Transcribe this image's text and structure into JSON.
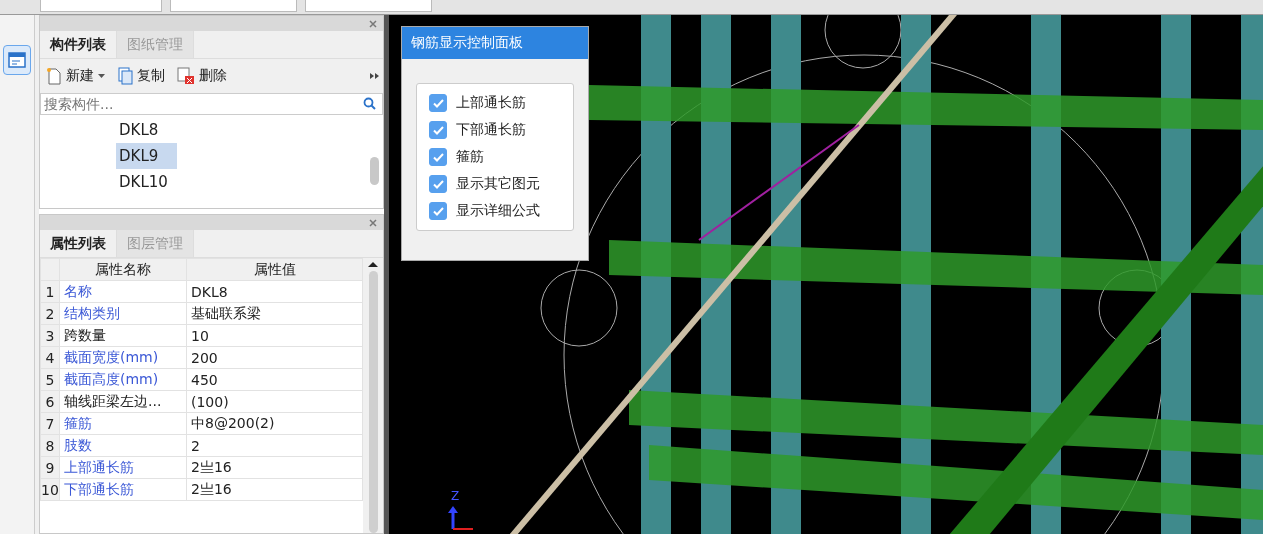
{
  "component_panel": {
    "tabs": [
      {
        "label": "构件列表",
        "selected": true
      },
      {
        "label": "图纸管理",
        "selected": false
      }
    ],
    "toolbar": [
      {
        "label": "新建",
        "kind": "new"
      },
      {
        "label": "复制",
        "kind": "copy"
      },
      {
        "label": "删除",
        "kind": "delete"
      }
    ],
    "search": {
      "placeholder": "搜索构件..."
    },
    "items": [
      {
        "label": "DKL8",
        "selected": false
      },
      {
        "label": "DKL9",
        "selected": true
      },
      {
        "label": "DKL10",
        "selected": false
      }
    ]
  },
  "property_panel": {
    "tabs": [
      {
        "label": "属性列表",
        "selected": true
      },
      {
        "label": "图层管理",
        "selected": false
      }
    ],
    "columns": [
      "属性名称",
      "属性值"
    ],
    "rows": [
      {
        "index": "1",
        "name": "名称",
        "value": "DKL8",
        "kind": "linked"
      },
      {
        "index": "2",
        "name": "结构类别",
        "value": "基础联系梁",
        "kind": "linked"
      },
      {
        "index": "3",
        "name": "跨数量",
        "value": "10",
        "kind": "plain"
      },
      {
        "index": "4",
        "name": "截面宽度(mm)",
        "value": "200",
        "kind": "linked"
      },
      {
        "index": "5",
        "name": "截面高度(mm)",
        "value": "450",
        "kind": "linked"
      },
      {
        "index": "6",
        "name": "轴线距梁左边...",
        "value": "(100)",
        "kind": "plain"
      },
      {
        "index": "7",
        "name": "箍筋",
        "value": "中8@200(2)",
        "kind": "linked"
      },
      {
        "index": "8",
        "name": "肢数",
        "value": "2",
        "kind": "linked"
      },
      {
        "index": "9",
        "name": "上部通长筋",
        "value": "2亗16",
        "kind": "linked"
      },
      {
        "index": "10",
        "name": "下部通长筋",
        "value": "2亗16",
        "kind": "linked"
      }
    ]
  },
  "rebar_panel": {
    "title": "钢筋显示控制面板",
    "options": [
      {
        "label": "上部通长筋",
        "checked": true
      },
      {
        "label": "下部通长筋",
        "checked": true
      },
      {
        "label": "箍筋",
        "checked": true
      },
      {
        "label": "显示其它图元",
        "checked": true
      },
      {
        "label": "显示详细公式",
        "checked": true
      }
    ]
  },
  "viewport": {
    "axis_label": "Z"
  }
}
